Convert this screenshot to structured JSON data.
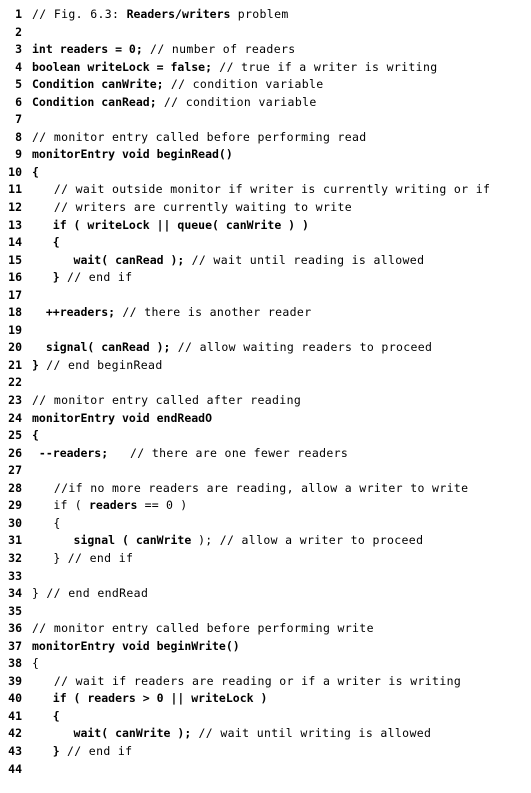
{
  "listing": {
    "figure_caption": "// Fig. 6.3: Readers/writers problem",
    "language": "java-like pseudocode",
    "total_lines": 44,
    "lines": [
      {
        "n": "1",
        "segments": [
          {
            "t": "// Fig. 6.3: ",
            "s": "cm"
          },
          {
            "t": "Readers/writers",
            "s": "kw"
          },
          {
            "t": " problem",
            "s": "cm"
          }
        ]
      },
      {
        "n": "2",
        "segments": []
      },
      {
        "n": "3",
        "segments": [
          {
            "t": "int readers = 0;",
            "s": "kw"
          },
          {
            "t": " // number of readers",
            "s": "cm"
          }
        ]
      },
      {
        "n": "4",
        "segments": [
          {
            "t": "boolean writeLock = false;",
            "s": "kw"
          },
          {
            "t": " // true if a writer is writing",
            "s": "cm"
          }
        ]
      },
      {
        "n": "5",
        "segments": [
          {
            "t": "Condition canWrite;",
            "s": "kw"
          },
          {
            "t": " // condition variable",
            "s": "cm"
          }
        ]
      },
      {
        "n": "6",
        "segments": [
          {
            "t": "Condition canRead;",
            "s": "kw"
          },
          {
            "t": " // condition variable",
            "s": "cm"
          }
        ]
      },
      {
        "n": "7",
        "segments": []
      },
      {
        "n": "8",
        "segments": [
          {
            "t": "// monitor entry called before performing read",
            "s": "cm"
          }
        ]
      },
      {
        "n": "9",
        "segments": [
          {
            "t": "monitorEntry void beginRead()",
            "s": "kw"
          }
        ]
      },
      {
        "n": "10",
        "segments": [
          {
            "t": "{",
            "s": "kw"
          }
        ]
      },
      {
        "n": "11",
        "segments": [
          {
            "t": "   // wait outside monitor if writer is currently writing or if",
            "s": "cm"
          }
        ]
      },
      {
        "n": "12",
        "segments": [
          {
            "t": "   // writers are currently waiting to write",
            "s": "cm"
          }
        ]
      },
      {
        "n": "13",
        "segments": [
          {
            "t": "   if ( writeLock || queue( canWrite ) )",
            "s": "kw"
          }
        ]
      },
      {
        "n": "14",
        "segments": [
          {
            "t": "   {",
            "s": "kw"
          }
        ]
      },
      {
        "n": "15",
        "segments": [
          {
            "t": "      wait( canRead );",
            "s": "kw"
          },
          {
            "t": " // wait until reading is allowed",
            "s": "cm"
          }
        ]
      },
      {
        "n": "16",
        "segments": [
          {
            "t": "   }",
            "s": "kw"
          },
          {
            "t": " // end if",
            "s": "cm"
          }
        ]
      },
      {
        "n": "17",
        "segments": []
      },
      {
        "n": "18",
        "segments": [
          {
            "t": "  ++readers;",
            "s": "kw"
          },
          {
            "t": " // there is another reader",
            "s": "cm"
          }
        ]
      },
      {
        "n": "19",
        "segments": []
      },
      {
        "n": "20",
        "segments": [
          {
            "t": "  signal( canRead );",
            "s": "kw"
          },
          {
            "t": " // allow waiting readers to proceed",
            "s": "cm"
          }
        ]
      },
      {
        "n": "21",
        "segments": [
          {
            "t": "}",
            "s": "kw"
          },
          {
            "t": " // end beginRead",
            "s": "cm"
          }
        ]
      },
      {
        "n": "22",
        "segments": []
      },
      {
        "n": "23",
        "segments": [
          {
            "t": "// monitor entry called after reading",
            "s": "cm"
          }
        ]
      },
      {
        "n": "24",
        "segments": [
          {
            "t": "monitorEntry void endReadO",
            "s": "kw"
          }
        ]
      },
      {
        "n": "25",
        "segments": [
          {
            "t": "{",
            "s": "kw"
          }
        ]
      },
      {
        "n": "26",
        "segments": [
          {
            "t": " --readers;",
            "s": "kw"
          },
          {
            "t": "   // there are one fewer readers",
            "s": "cm"
          }
        ]
      },
      {
        "n": "27",
        "segments": []
      },
      {
        "n": "28",
        "segments": [
          {
            "t": "   //if no more readers are reading, allow a writer to write",
            "s": "cm"
          }
        ]
      },
      {
        "n": "29",
        "segments": [
          {
            "t": "   if ( ",
            "s": "pl"
          },
          {
            "t": "readers",
            "s": "kw"
          },
          {
            "t": " == 0 )",
            "s": "pl"
          }
        ]
      },
      {
        "n": "30",
        "segments": [
          {
            "t": "   {",
            "s": "pl"
          }
        ]
      },
      {
        "n": "31",
        "segments": [
          {
            "t": "      signal ( canWrite ",
            "s": "kw"
          },
          {
            "t": ");",
            "s": "pl"
          },
          {
            "t": " // allow a writer to proceed",
            "s": "cm"
          }
        ]
      },
      {
        "n": "32",
        "segments": [
          {
            "t": "   }",
            "s": "pl"
          },
          {
            "t": " // end if",
            "s": "cm"
          }
        ]
      },
      {
        "n": "33",
        "segments": []
      },
      {
        "n": "34",
        "segments": [
          {
            "t": "}",
            "s": "pl"
          },
          {
            "t": " // end endRead",
            "s": "cm"
          }
        ]
      },
      {
        "n": "35",
        "segments": []
      },
      {
        "n": "36",
        "segments": [
          {
            "t": "// monitor entry called before performing write",
            "s": "cm"
          }
        ]
      },
      {
        "n": "37",
        "segments": [
          {
            "t": "monitorEntry void beginWrite()",
            "s": "kw"
          }
        ]
      },
      {
        "n": "38",
        "segments": [
          {
            "t": "{",
            "s": "pl"
          }
        ]
      },
      {
        "n": "39",
        "segments": [
          {
            "t": "   // wait if readers are reading or if a writer is writing",
            "s": "cm"
          }
        ]
      },
      {
        "n": "40",
        "segments": [
          {
            "t": "   if ( readers > 0 || writeLock )",
            "s": "kw"
          }
        ]
      },
      {
        "n": "41",
        "segments": [
          {
            "t": "   {",
            "s": "kw"
          }
        ]
      },
      {
        "n": "42",
        "segments": [
          {
            "t": "      wait( canWrite );",
            "s": "kw"
          },
          {
            "t": " // wait until writing is allowed",
            "s": "cm"
          }
        ]
      },
      {
        "n": "43",
        "segments": [
          {
            "t": "   }",
            "s": "kw"
          },
          {
            "t": " // end if",
            "s": "cm"
          }
        ]
      },
      {
        "n": "44",
        "segments": []
      }
    ]
  }
}
